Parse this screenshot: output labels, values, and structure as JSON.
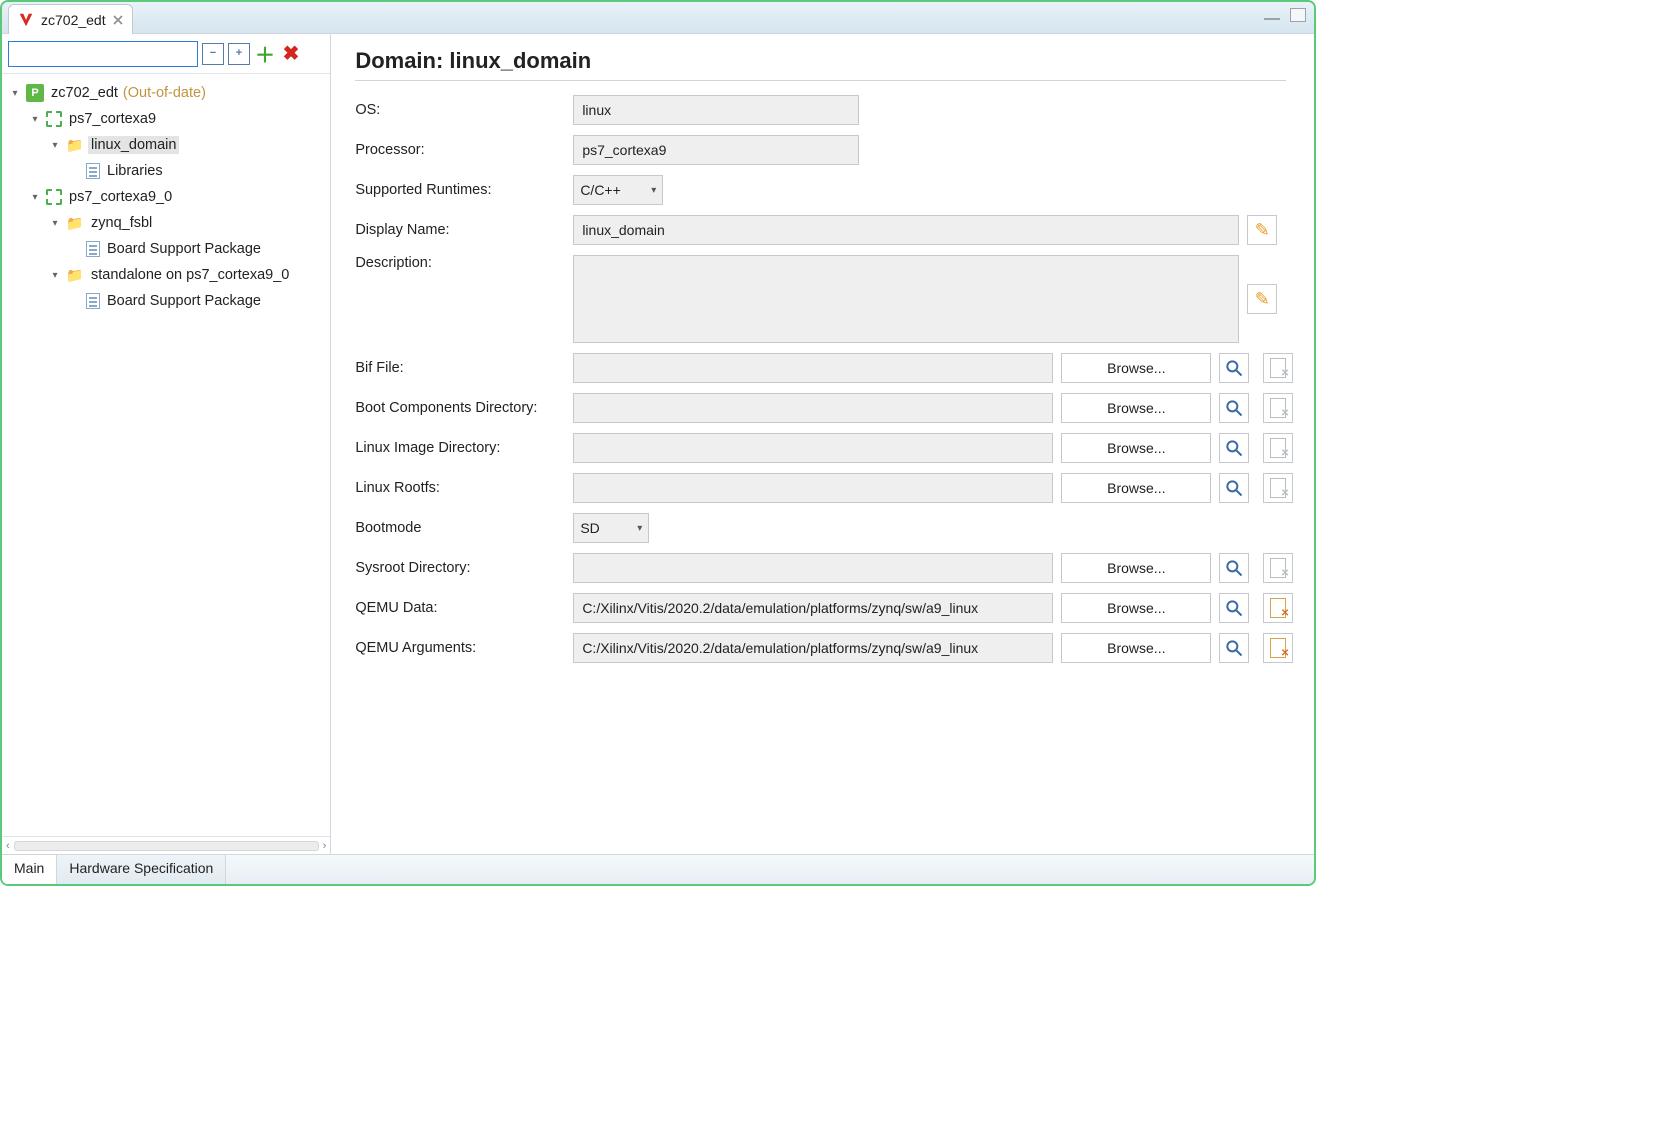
{
  "tab": {
    "title": "zc702_edt"
  },
  "tree": {
    "root": {
      "label": "zc702_edt",
      "status": "(Out-of-date)"
    },
    "cortexa9": {
      "label": "ps7_cortexa9"
    },
    "linux_domain": {
      "label": "linux_domain"
    },
    "libraries": {
      "label": "Libraries"
    },
    "cortexa9_0": {
      "label": "ps7_cortexa9_0"
    },
    "zynq_fsbl": {
      "label": "zynq_fsbl"
    },
    "bsp1": {
      "label": "Board Support Package"
    },
    "standalone": {
      "label": "standalone on ps7_cortexa9_0"
    },
    "bsp2": {
      "label": "Board Support Package"
    }
  },
  "heading": "Domain: linux_domain",
  "form": {
    "os": {
      "label": "OS:",
      "value": "linux"
    },
    "processor": {
      "label": "Processor:",
      "value": "ps7_cortexa9"
    },
    "runtimes": {
      "label": "Supported Runtimes:",
      "value": "C/C++"
    },
    "display_name": {
      "label": "Display Name:",
      "value": "linux_domain"
    },
    "description": {
      "label": "Description:",
      "value": ""
    },
    "bif": {
      "label": "Bif File:",
      "value": "",
      "browse": "Browse..."
    },
    "boot_components": {
      "label": "Boot Components Directory:",
      "value": "",
      "browse": "Browse..."
    },
    "linux_image": {
      "label": "Linux Image Directory:",
      "value": "",
      "browse": "Browse..."
    },
    "linux_rootfs": {
      "label": "Linux Rootfs:",
      "value": "",
      "browse": "Browse..."
    },
    "bootmode": {
      "label": "Bootmode",
      "value": "SD"
    },
    "sysroot": {
      "label": "Sysroot Directory:",
      "value": "",
      "browse": "Browse..."
    },
    "qemu_data": {
      "label": "QEMU Data:",
      "value": "C:/Xilinx/Vitis/2020.2/data/emulation/platforms/zynq/sw/a9_linux",
      "browse": "Browse..."
    },
    "qemu_args": {
      "label": "QEMU Arguments:",
      "value": "C:/Xilinx/Vitis/2020.2/data/emulation/platforms/zynq/sw/a9_linux",
      "browse": "Browse..."
    }
  },
  "bottom_tabs": {
    "main": "Main",
    "hw": "Hardware Specification"
  }
}
